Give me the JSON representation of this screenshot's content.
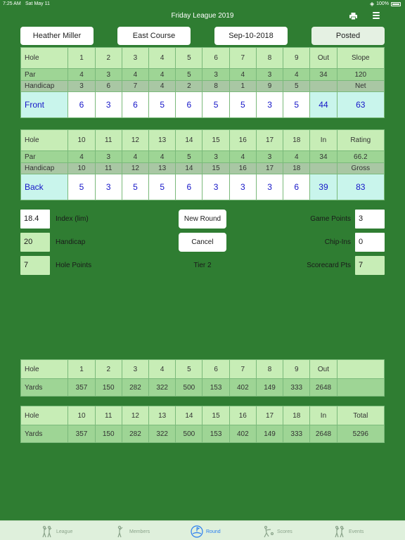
{
  "status": {
    "time": "7:25 AM",
    "date": "Sat May 11",
    "battery": "100%"
  },
  "nav": {
    "title": "Friday League 2019"
  },
  "header": {
    "player": "Heather Miller",
    "course": "East Course",
    "date": "Sep-10-2018",
    "status": "Posted"
  },
  "front": {
    "hole_label": "Hole",
    "holes": [
      "1",
      "2",
      "3",
      "4",
      "5",
      "6",
      "7",
      "8",
      "9"
    ],
    "total_label": "Out",
    "extra_label": "Slope",
    "par_label": "Par",
    "par": [
      "4",
      "3",
      "4",
      "4",
      "5",
      "3",
      "4",
      "3",
      "4"
    ],
    "par_total": "34",
    "extra_par": "120",
    "hcp_label": "Handicap",
    "hcp": [
      "3",
      "6",
      "7",
      "4",
      "2",
      "8",
      "1",
      "9",
      "5"
    ],
    "hcp_total": "",
    "extra_hcp": "Net",
    "score_label": "Front",
    "scores": [
      "6",
      "3",
      "6",
      "5",
      "6",
      "5",
      "5",
      "3",
      "5"
    ],
    "score_total": "44",
    "extra_score": "63"
  },
  "back": {
    "hole_label": "Hole",
    "holes": [
      "10",
      "11",
      "12",
      "13",
      "14",
      "15",
      "16",
      "17",
      "18"
    ],
    "total_label": "In",
    "extra_label": "Rating",
    "par_label": "Par",
    "par": [
      "4",
      "3",
      "4",
      "4",
      "5",
      "3",
      "4",
      "3",
      "4"
    ],
    "par_total": "34",
    "extra_par": "66.2",
    "hcp_label": "Handicap",
    "hcp": [
      "10",
      "11",
      "12",
      "13",
      "14",
      "15",
      "16",
      "17",
      "18"
    ],
    "hcp_total": "",
    "extra_hcp": "Gross",
    "score_label": "Back",
    "scores": [
      "5",
      "3",
      "5",
      "5",
      "6",
      "3",
      "3",
      "3",
      "6"
    ],
    "score_total": "39",
    "extra_score": "83"
  },
  "fields": {
    "index": {
      "value": "18.4",
      "label": "Index (lim)"
    },
    "handicap": {
      "value": "20",
      "label": "Handicap"
    },
    "hole_points": {
      "value": "7",
      "label": "Hole Points"
    },
    "new_round": "New Round",
    "cancel": "Cancel",
    "tier": "Tier 2",
    "game_points": {
      "label": "Game Points",
      "value": "3"
    },
    "chip_ins": {
      "label": "Chip-Ins",
      "value": "0"
    },
    "scorecard_pts": {
      "label": "Scorecard Pts",
      "value": "7"
    }
  },
  "yards_front": {
    "hole_label": "Hole",
    "holes": [
      "1",
      "2",
      "3",
      "4",
      "5",
      "6",
      "7",
      "8",
      "9"
    ],
    "total_label": "Out",
    "extra_label": "",
    "yards_label": "Yards",
    "yards": [
      "357",
      "150",
      "282",
      "322",
      "500",
      "153",
      "402",
      "149",
      "333"
    ],
    "yards_total": "2648",
    "extra_yards": ""
  },
  "yards_back": {
    "hole_label": "Hole",
    "holes": [
      "10",
      "11",
      "12",
      "13",
      "14",
      "15",
      "16",
      "17",
      "18"
    ],
    "total_label": "In",
    "extra_label": "Total",
    "yards_label": "Yards",
    "yards": [
      "357",
      "150",
      "282",
      "322",
      "500",
      "153",
      "402",
      "149",
      "333"
    ],
    "yards_total": "2648",
    "extra_yards": "5296"
  },
  "tabs": [
    {
      "label": "League",
      "icon": "league-icon"
    },
    {
      "label": "Members",
      "icon": "members-icon"
    },
    {
      "label": "Round",
      "icon": "round-icon"
    },
    {
      "label": "Scores",
      "icon": "scores-icon"
    },
    {
      "label": "Events",
      "icon": "events-icon"
    }
  ]
}
